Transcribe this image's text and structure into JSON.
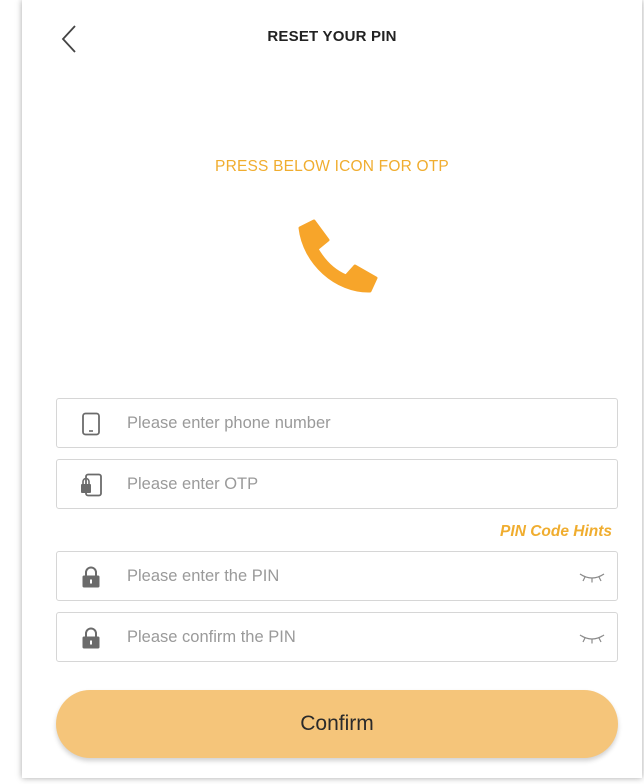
{
  "header": {
    "title": "RESET YOUR PIN"
  },
  "otp": {
    "hint": "PRESS BELOW ICON FOR OTP"
  },
  "form": {
    "phone": {
      "placeholder": "Please enter phone number",
      "value": ""
    },
    "otp": {
      "placeholder": "Please enter OTP",
      "value": ""
    },
    "pin_hints_label": "PIN Code Hints",
    "pin": {
      "placeholder": "Please enter the PIN",
      "value": ""
    },
    "confirm_pin": {
      "placeholder": "Please confirm the PIN",
      "value": ""
    }
  },
  "actions": {
    "confirm_label": "Confirm"
  },
  "icons": {
    "back": "chevron-left-icon",
    "call": "phone-icon",
    "phone_field": "mobile-phone-icon",
    "otp_field": "otp-device-icon",
    "pin_field": "lock-icon",
    "visibility": "eye-closed-icon"
  },
  "colors": {
    "accent": "#f0ad2f",
    "phone_icon": "#f7a52a",
    "button": "#f5c57a",
    "field_icon": "#6b6b6b"
  }
}
